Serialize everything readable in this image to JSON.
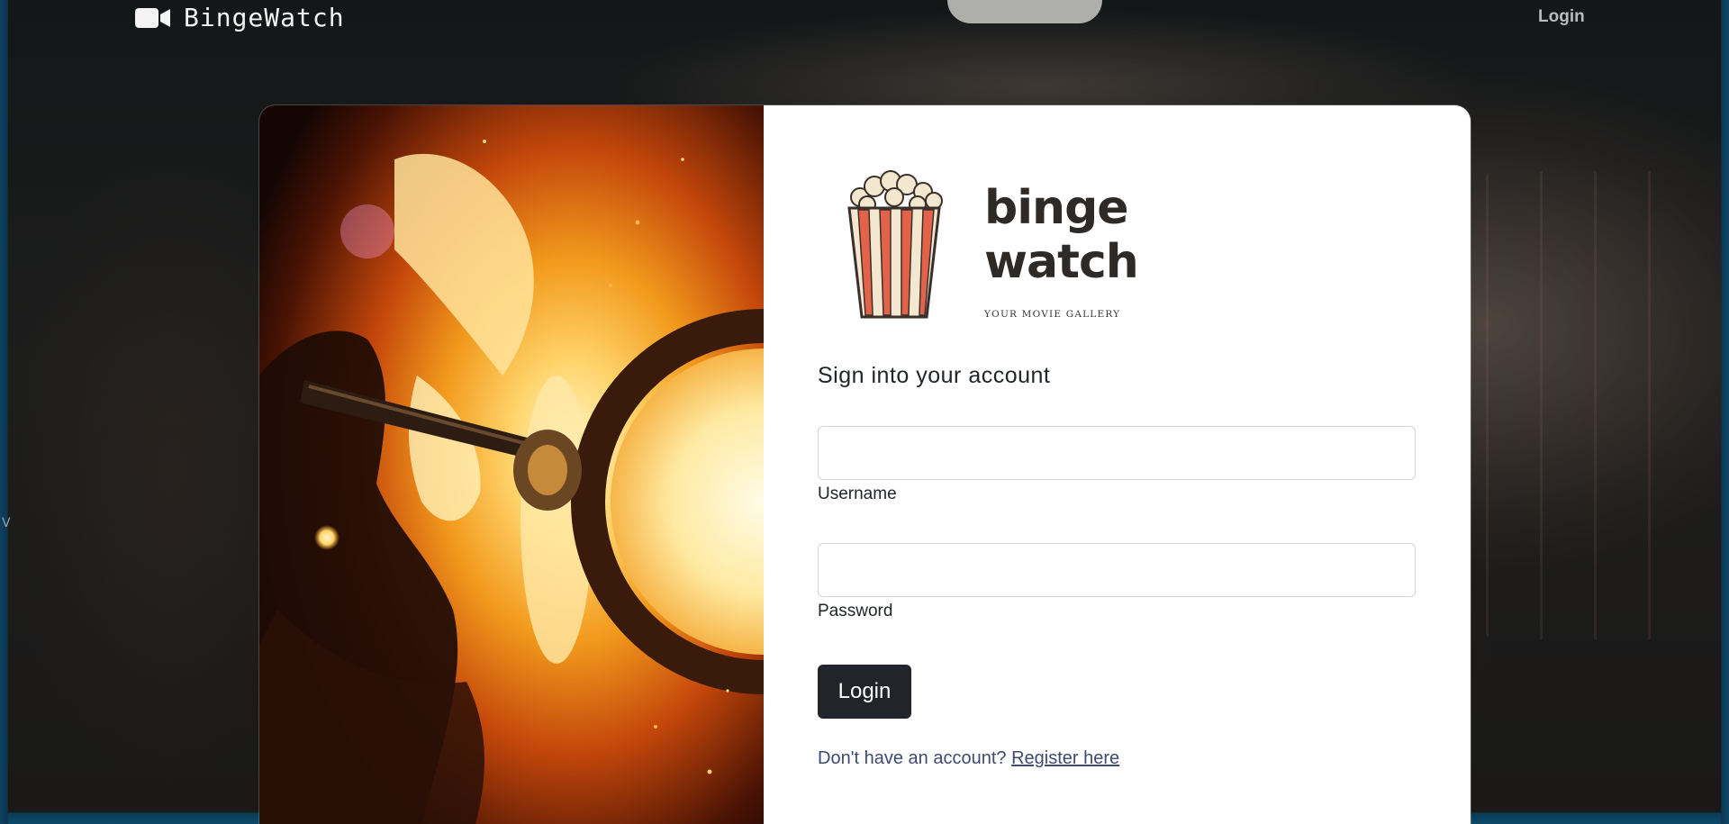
{
  "navbar": {
    "brand_name": "BingeWatch",
    "brand_icon": "video-camera-icon",
    "login_link": "Login"
  },
  "logo": {
    "word1": "binge",
    "word2": "watch",
    "tagline": "YOUR MOVIE GALLERY",
    "icon": "popcorn-icon"
  },
  "form": {
    "heading": "Sign into your account",
    "username_label": "Username",
    "username_value": "",
    "password_label": "Password",
    "password_value": "",
    "submit_label": "Login"
  },
  "register": {
    "prompt": "Don't have an account?",
    "link_text": "Register here"
  },
  "edge_text": "V",
  "colors": {
    "primary_button": "#212529",
    "link": "#3e4a72",
    "page_background": "#141718"
  }
}
